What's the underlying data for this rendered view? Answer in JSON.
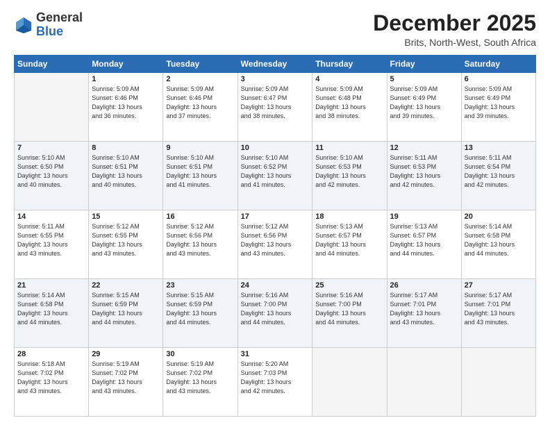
{
  "logo": {
    "general": "General",
    "blue": "Blue"
  },
  "header": {
    "month": "December 2025",
    "location": "Brits, North-West, South Africa"
  },
  "days_of_week": [
    "Sunday",
    "Monday",
    "Tuesday",
    "Wednesday",
    "Thursday",
    "Friday",
    "Saturday"
  ],
  "weeks": [
    [
      {
        "day": "",
        "info": ""
      },
      {
        "day": "1",
        "info": "Sunrise: 5:09 AM\nSunset: 6:46 PM\nDaylight: 13 hours\nand 36 minutes."
      },
      {
        "day": "2",
        "info": "Sunrise: 5:09 AM\nSunset: 6:46 PM\nDaylight: 13 hours\nand 37 minutes."
      },
      {
        "day": "3",
        "info": "Sunrise: 5:09 AM\nSunset: 6:47 PM\nDaylight: 13 hours\nand 38 minutes."
      },
      {
        "day": "4",
        "info": "Sunrise: 5:09 AM\nSunset: 6:48 PM\nDaylight: 13 hours\nand 38 minutes."
      },
      {
        "day": "5",
        "info": "Sunrise: 5:09 AM\nSunset: 6:49 PM\nDaylight: 13 hours\nand 39 minutes."
      },
      {
        "day": "6",
        "info": "Sunrise: 5:09 AM\nSunset: 6:49 PM\nDaylight: 13 hours\nand 39 minutes."
      }
    ],
    [
      {
        "day": "7",
        "info": "Sunrise: 5:10 AM\nSunset: 6:50 PM\nDaylight: 13 hours\nand 40 minutes."
      },
      {
        "day": "8",
        "info": "Sunrise: 5:10 AM\nSunset: 6:51 PM\nDaylight: 13 hours\nand 40 minutes."
      },
      {
        "day": "9",
        "info": "Sunrise: 5:10 AM\nSunset: 6:51 PM\nDaylight: 13 hours\nand 41 minutes."
      },
      {
        "day": "10",
        "info": "Sunrise: 5:10 AM\nSunset: 6:52 PM\nDaylight: 13 hours\nand 41 minutes."
      },
      {
        "day": "11",
        "info": "Sunrise: 5:10 AM\nSunset: 6:53 PM\nDaylight: 13 hours\nand 42 minutes."
      },
      {
        "day": "12",
        "info": "Sunrise: 5:11 AM\nSunset: 6:53 PM\nDaylight: 13 hours\nand 42 minutes."
      },
      {
        "day": "13",
        "info": "Sunrise: 5:11 AM\nSunset: 6:54 PM\nDaylight: 13 hours\nand 42 minutes."
      }
    ],
    [
      {
        "day": "14",
        "info": "Sunrise: 5:11 AM\nSunset: 6:55 PM\nDaylight: 13 hours\nand 43 minutes."
      },
      {
        "day": "15",
        "info": "Sunrise: 5:12 AM\nSunset: 6:55 PM\nDaylight: 13 hours\nand 43 minutes."
      },
      {
        "day": "16",
        "info": "Sunrise: 5:12 AM\nSunset: 6:56 PM\nDaylight: 13 hours\nand 43 minutes."
      },
      {
        "day": "17",
        "info": "Sunrise: 5:12 AM\nSunset: 6:56 PM\nDaylight: 13 hours\nand 43 minutes."
      },
      {
        "day": "18",
        "info": "Sunrise: 5:13 AM\nSunset: 6:57 PM\nDaylight: 13 hours\nand 44 minutes."
      },
      {
        "day": "19",
        "info": "Sunrise: 5:13 AM\nSunset: 6:57 PM\nDaylight: 13 hours\nand 44 minutes."
      },
      {
        "day": "20",
        "info": "Sunrise: 5:14 AM\nSunset: 6:58 PM\nDaylight: 13 hours\nand 44 minutes."
      }
    ],
    [
      {
        "day": "21",
        "info": "Sunrise: 5:14 AM\nSunset: 6:58 PM\nDaylight: 13 hours\nand 44 minutes."
      },
      {
        "day": "22",
        "info": "Sunrise: 5:15 AM\nSunset: 6:59 PM\nDaylight: 13 hours\nand 44 minutes."
      },
      {
        "day": "23",
        "info": "Sunrise: 5:15 AM\nSunset: 6:59 PM\nDaylight: 13 hours\nand 44 minutes."
      },
      {
        "day": "24",
        "info": "Sunrise: 5:16 AM\nSunset: 7:00 PM\nDaylight: 13 hours\nand 44 minutes."
      },
      {
        "day": "25",
        "info": "Sunrise: 5:16 AM\nSunset: 7:00 PM\nDaylight: 13 hours\nand 44 minutes."
      },
      {
        "day": "26",
        "info": "Sunrise: 5:17 AM\nSunset: 7:01 PM\nDaylight: 13 hours\nand 43 minutes."
      },
      {
        "day": "27",
        "info": "Sunrise: 5:17 AM\nSunset: 7:01 PM\nDaylight: 13 hours\nand 43 minutes."
      }
    ],
    [
      {
        "day": "28",
        "info": "Sunrise: 5:18 AM\nSunset: 7:02 PM\nDaylight: 13 hours\nand 43 minutes."
      },
      {
        "day": "29",
        "info": "Sunrise: 5:19 AM\nSunset: 7:02 PM\nDaylight: 13 hours\nand 43 minutes."
      },
      {
        "day": "30",
        "info": "Sunrise: 5:19 AM\nSunset: 7:02 PM\nDaylight: 13 hours\nand 43 minutes."
      },
      {
        "day": "31",
        "info": "Sunrise: 5:20 AM\nSunset: 7:03 PM\nDaylight: 13 hours\nand 42 minutes."
      },
      {
        "day": "",
        "info": ""
      },
      {
        "day": "",
        "info": ""
      },
      {
        "day": "",
        "info": ""
      }
    ]
  ]
}
